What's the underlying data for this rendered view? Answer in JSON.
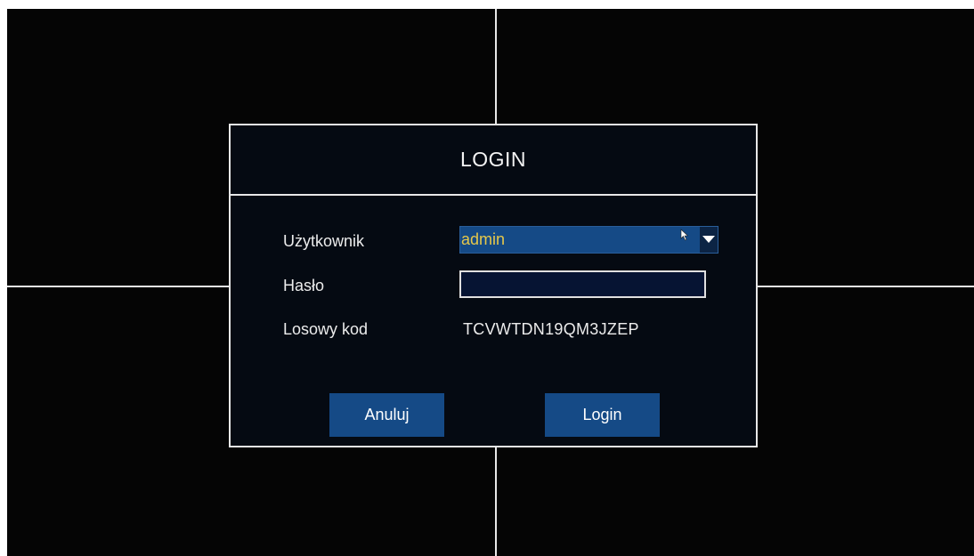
{
  "dialog": {
    "title": "LOGIN"
  },
  "form": {
    "user_label": "Użytkownik",
    "user_value": "admin",
    "password_label": "Hasło",
    "password_value": "",
    "code_label": "Losowy kod",
    "code_value": "TCVWTDN19QM3JZEP"
  },
  "buttons": {
    "cancel_label": "Anuluj",
    "login_label": "Login"
  },
  "icons": {
    "dropdown": "chevron-down-icon",
    "cursor": "mouse-pointer-icon"
  },
  "colors": {
    "background": "#050505",
    "accent": "#154a86",
    "selected_text": "#e6c84a",
    "border": "#e8e8e8"
  }
}
